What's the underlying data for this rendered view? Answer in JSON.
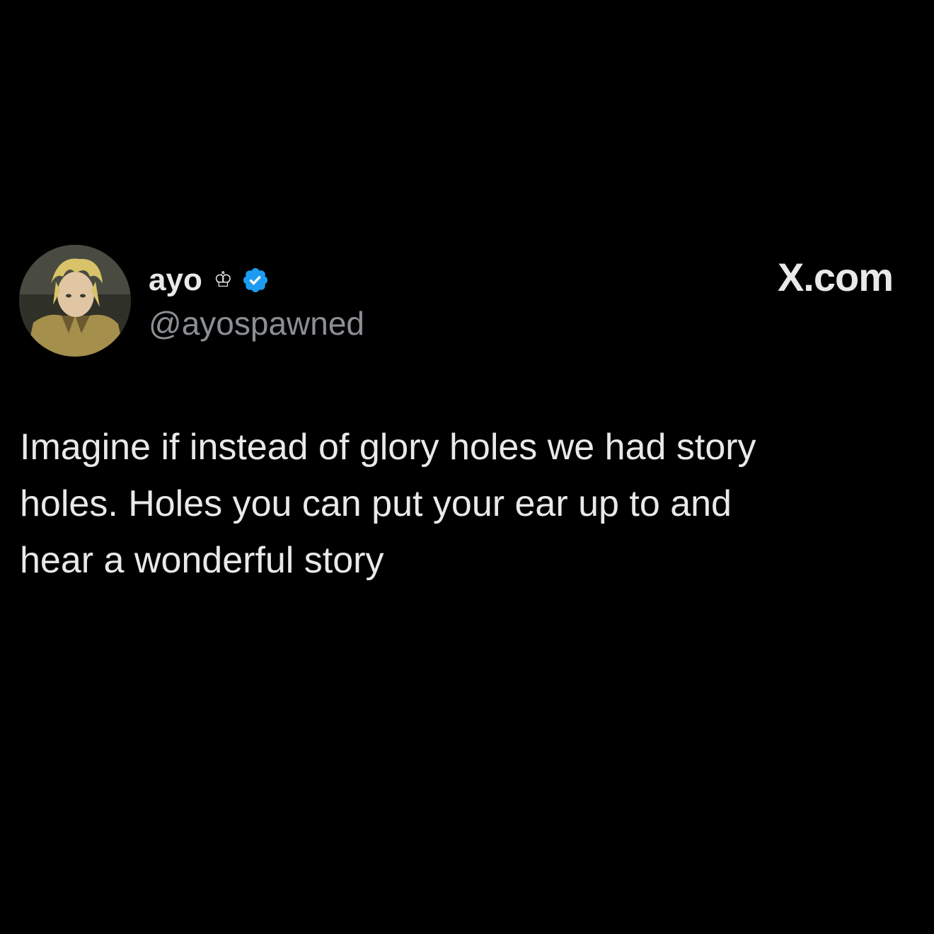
{
  "tweet": {
    "display_name": "ayo",
    "crown_glyph": "♔",
    "handle": "@ayospawned",
    "brand": "X.com",
    "text": "Imagine if instead of glory holes we had story\nholes. Holes you can put your ear up to and\nhear a wonderful story"
  },
  "icons": {
    "avatar": "anime-character-avatar",
    "crown": "crown-icon",
    "verified": "verified-badge-icon"
  },
  "colors": {
    "background": "#000000",
    "text_primary": "#e7e9ea",
    "text_secondary": "#8b8f94",
    "verified_blue": "#1d9bf0"
  }
}
